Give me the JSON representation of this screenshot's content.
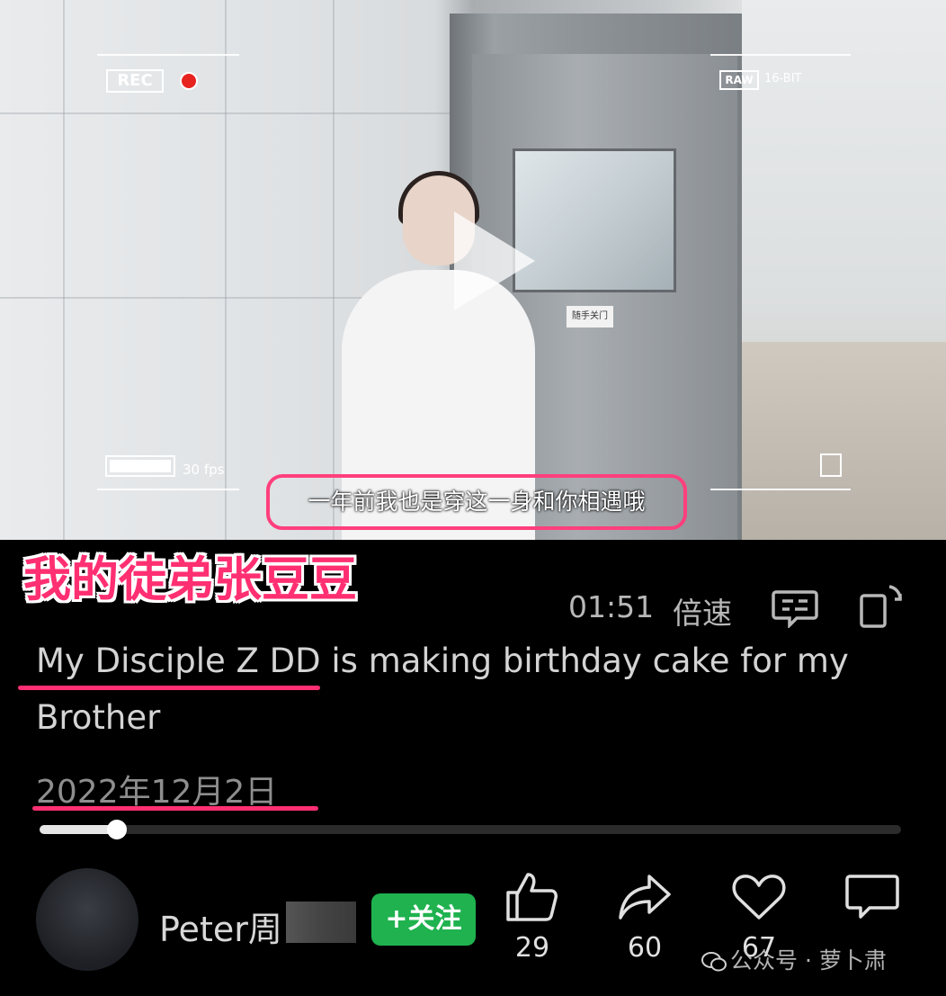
{
  "video": {
    "rec_label": "REC",
    "raw_label": "RAW",
    "bit_label": "16-BIT",
    "fps_label": "30 fps",
    "door_sign": "随手关门",
    "subtitle": "一年前我也是穿这一身和你相遇哦"
  },
  "overlay_title": "我的徒弟张豆豆",
  "player": {
    "duration": "01:51",
    "speed_label": "倍速",
    "progress": 0.09
  },
  "description": "My Disciple Z DD is making birthday cake for my Brother",
  "date": "2022年12月2日",
  "author": {
    "name": "Peter周",
    "follow_label": "+关注"
  },
  "actions": {
    "like_count": "29",
    "share_count": "60",
    "favorite_count": "67"
  },
  "watermark": "公众号 · 萝卜肃",
  "colors": {
    "highlight": "#ff2f72",
    "follow_green": "#1fb24f",
    "rec_red": "#e7231f"
  },
  "icons": [
    "play-icon",
    "rec-dot-icon",
    "battery-icon",
    "danmu-icon",
    "rotate-screen-icon",
    "thumbs-up-icon",
    "share-icon",
    "heart-icon",
    "comment-icon",
    "wechat-icon"
  ]
}
